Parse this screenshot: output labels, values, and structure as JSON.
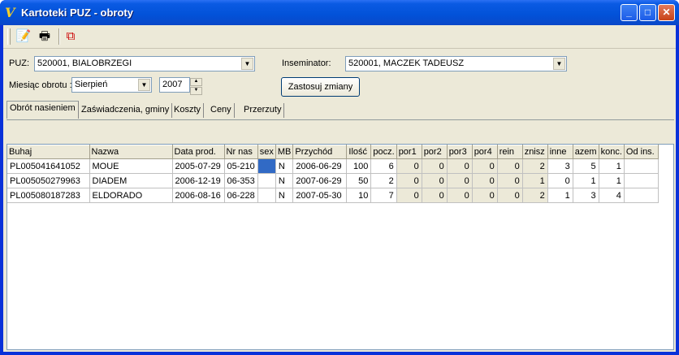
{
  "window": {
    "title": "Kartoteki PUZ - obroty"
  },
  "toolbar": {
    "icons": [
      "edit-icon",
      "print-icon",
      "close-window-icon"
    ]
  },
  "form": {
    "puz_label": "PUZ:",
    "puz_value": "520001, BIALOBRZEGI",
    "inseminator_label": "Inseminator:",
    "inseminator_value": "520001, MACZEK TADEUSZ",
    "month_label": "Miesiąc obrotu :",
    "month_value": "Sierpień",
    "year_value": "2007",
    "apply_label": "Zastosuj zmiany"
  },
  "tabs": [
    {
      "label": "Obrót nasieniem"
    },
    {
      "label": "Zaświadczenia, gminy"
    },
    {
      "label": "Koszty"
    },
    {
      "label": "Ceny"
    },
    {
      "label": "Przerzuty"
    }
  ],
  "grid": {
    "headers": [
      "Buhaj",
      "Nazwa",
      "Data prod.",
      "Nr nas",
      "sex",
      "MB",
      "Przychód",
      "Ilość",
      "pocz.",
      "por1",
      "por2",
      "por3",
      "por4",
      "rein",
      "znisz",
      "inne",
      "azem",
      "konc.",
      "Od ins."
    ],
    "rows": [
      [
        "PL005041641052",
        "MOUE",
        "2005-07-29",
        "05-210",
        "",
        "N",
        "2006-06-29",
        "100",
        "6",
        "0",
        "0",
        "0",
        "0",
        "0",
        "2",
        "3",
        "5",
        "1",
        ""
      ],
      [
        "PL005050279963",
        "DIADEM",
        "2006-12-19",
        "06-353",
        "",
        "N",
        "2007-06-29",
        "50",
        "2",
        "0",
        "0",
        "0",
        "0",
        "0",
        "1",
        "0",
        "1",
        "1",
        ""
      ],
      [
        "PL005080187283",
        "ELDORADO",
        "2006-08-16",
        "06-228",
        "",
        "N",
        "2007-05-30",
        "10",
        "7",
        "0",
        "0",
        "0",
        "0",
        "0",
        "2",
        "1",
        "3",
        "4",
        ""
      ]
    ]
  }
}
